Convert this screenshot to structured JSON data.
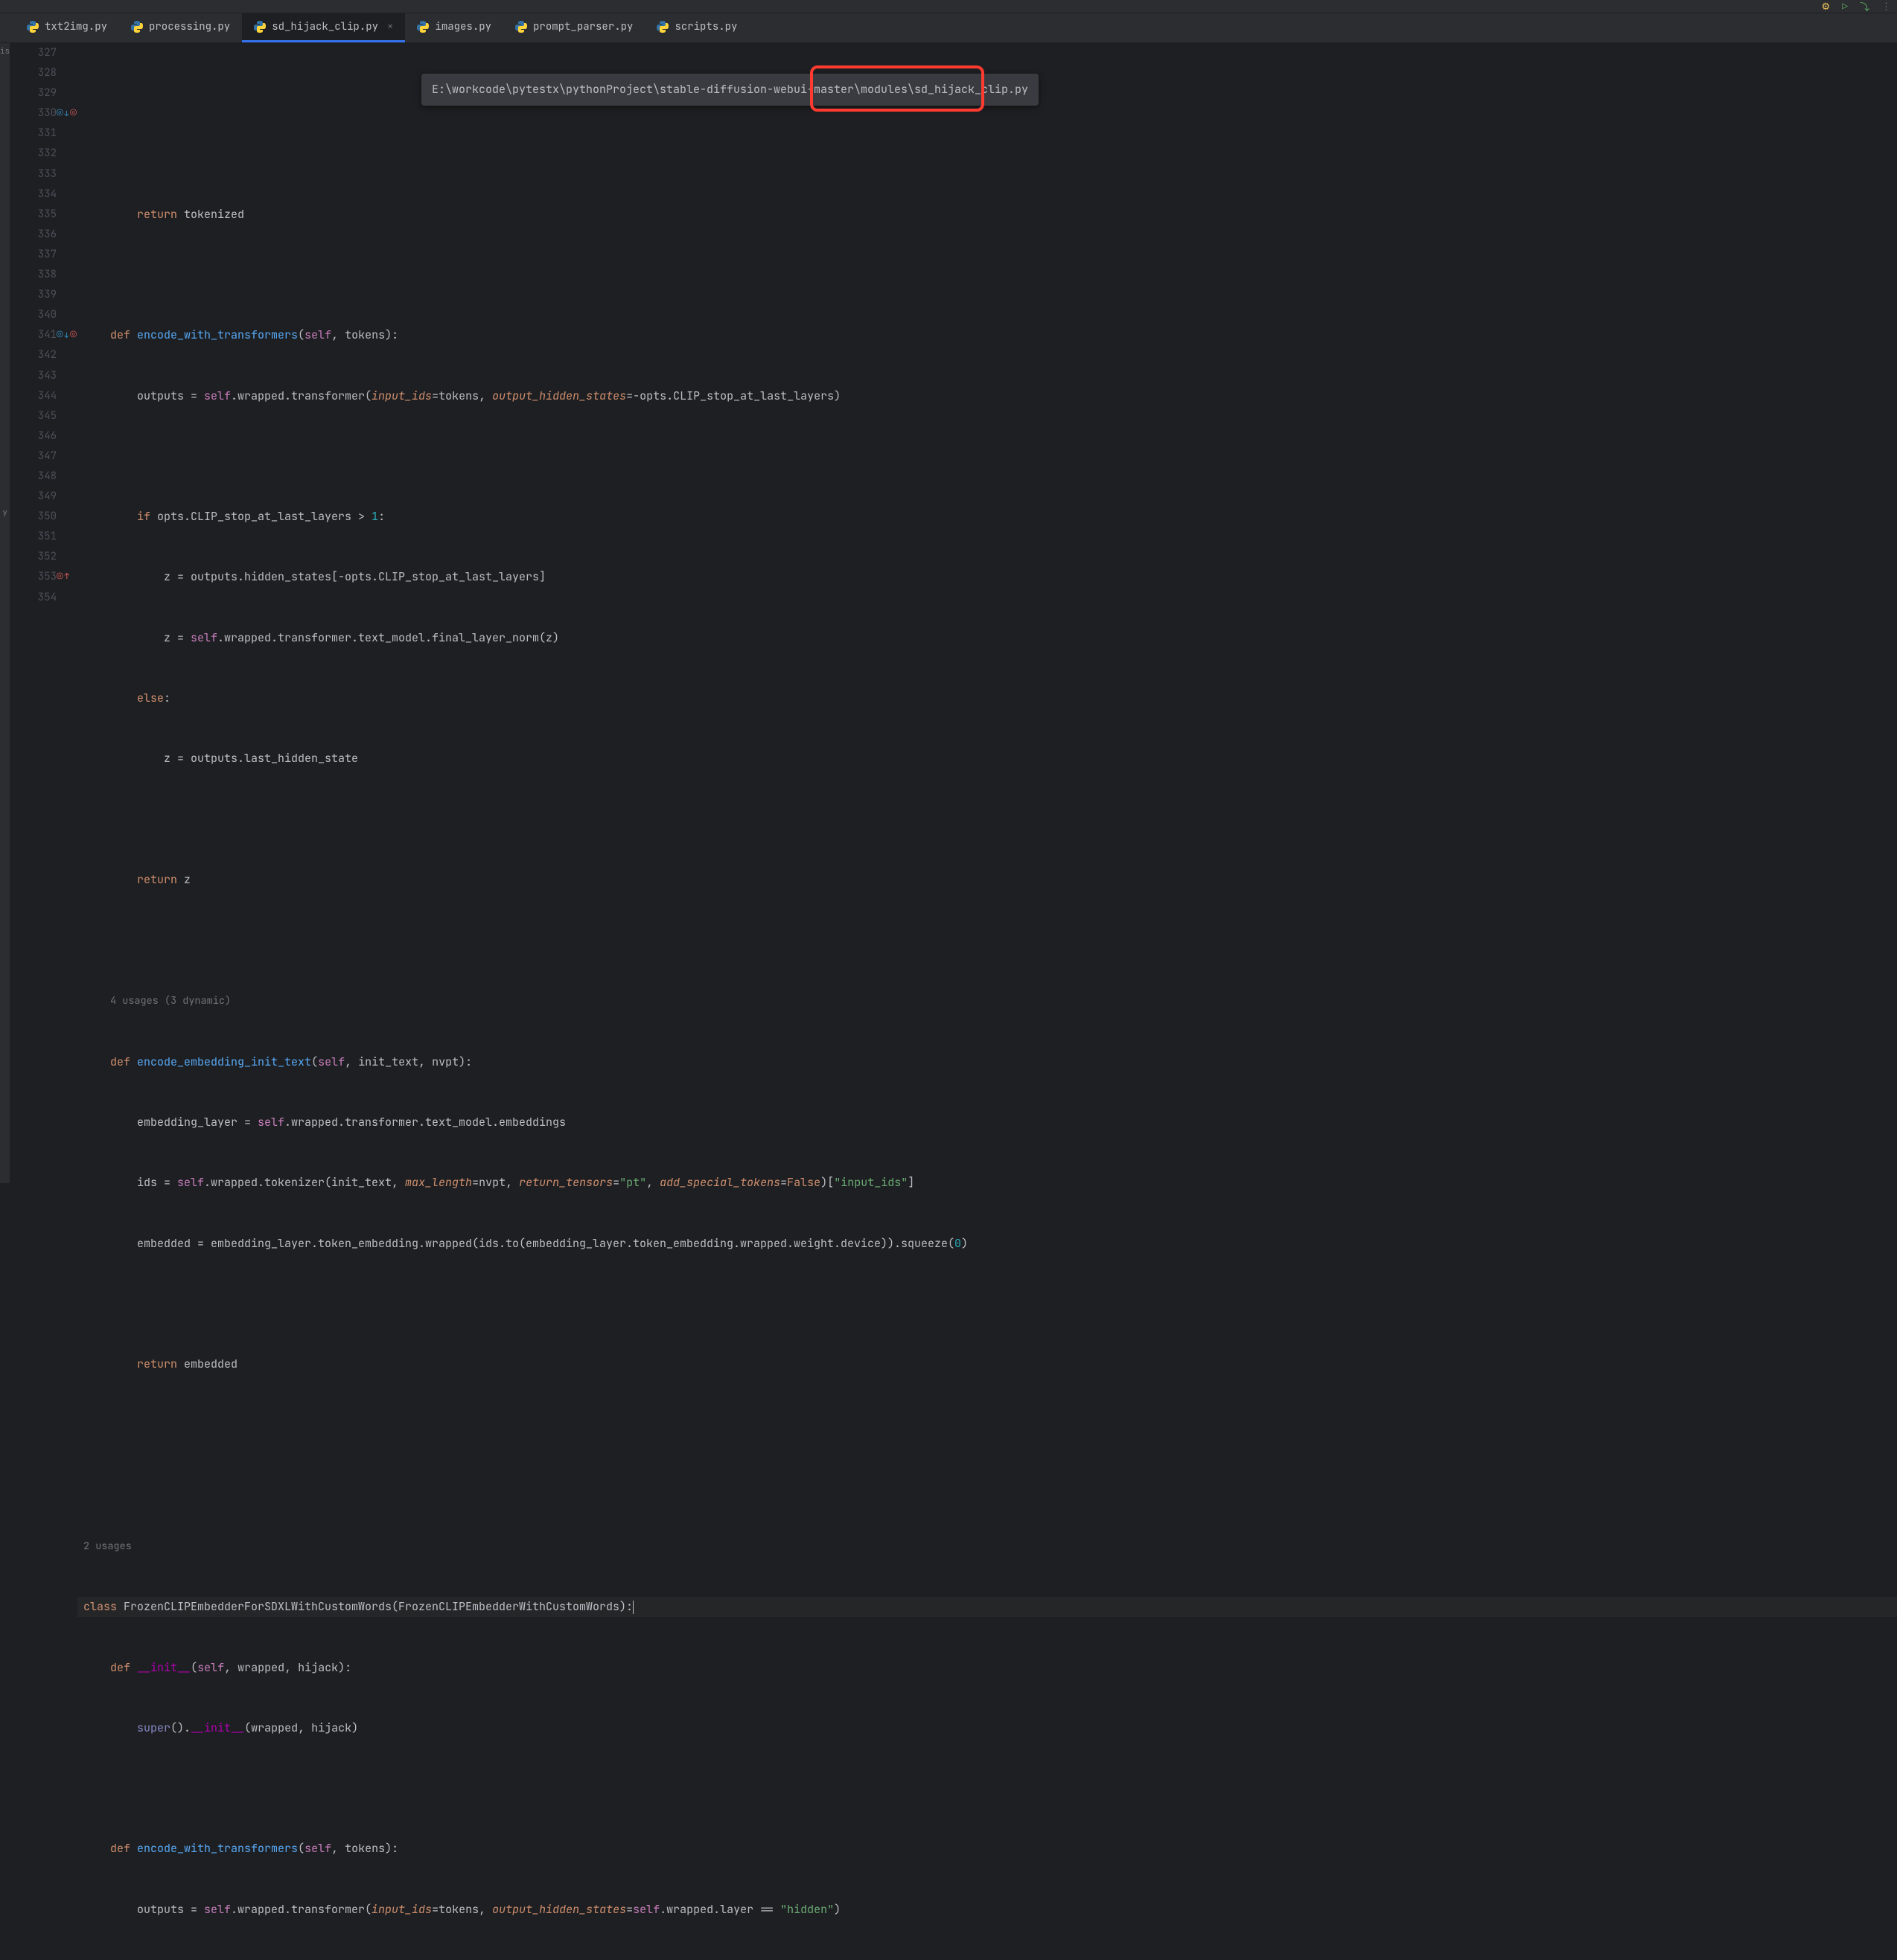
{
  "toolbar": {
    "title_fragment": "",
    "right_glyphs": [
      "⟳",
      "▷",
      "⋮"
    ]
  },
  "tabs": [
    {
      "label": "txt2img.py",
      "active": false,
      "closeable": false
    },
    {
      "label": "processing.py",
      "active": false,
      "closeable": false
    },
    {
      "label": "sd_hijack_clip.py",
      "active": true,
      "closeable": true
    },
    {
      "label": "images.py",
      "active": false,
      "closeable": false
    },
    {
      "label": "prompt_parser.py",
      "active": false,
      "closeable": false
    },
    {
      "label": "scripts.py",
      "active": false,
      "closeable": false
    }
  ],
  "tooltip_path": "E:\\workcode\\pytestx\\pythonProject\\stable-diffusion-webui-master\\modules\\sd_hijack_clip.py",
  "gutter": {
    "lines": [
      "327",
      "328",
      "329",
      "330",
      "331",
      "332",
      "333",
      "334",
      "335",
      "336",
      "337",
      "338",
      "339",
      "340",
      "",
      "341",
      "342",
      "343",
      "344",
      "345",
      "346",
      "347",
      "348",
      "",
      "349",
      "350",
      "351",
      "352",
      "353",
      "354"
    ],
    "markers": {
      "330": "usage-down",
      "341": "usage-down",
      "353": "override-up"
    }
  },
  "annotations": {
    "usage_341": "4 usages (3 dynamic)",
    "usage_349": "2 usages"
  },
  "code": {
    "l327": "",
    "l328": {
      "kw": "return",
      "rest": " tokenized"
    },
    "l329": "",
    "l330": {
      "kw": "def ",
      "fn": "encode_with_transformers",
      "sig_open": "(",
      "self": "self",
      "sig_rest": ", tokens):"
    },
    "l331": {
      "pre": "        outputs = ",
      "self": "self",
      "mid": ".wrapped.transformer(",
      "arg1": "input_ids",
      "eq1": "=tokens, ",
      "arg2": "output_hidden_states",
      "eq2": "=-opts.CLIP_stop_at_last_layers)"
    },
    "l332": "",
    "l333": {
      "kw": "if",
      "rest": " opts.CLIP_stop_at_last_layers > ",
      "num": "1",
      "tail": ":"
    },
    "l334": "            z = outputs.hidden_states[-opts.CLIP_stop_at_last_layers]",
    "l335": {
      "pre": "            z = ",
      "self": "self",
      "rest": ".wrapped.transformer.text_model.final_layer_norm(z)"
    },
    "l336": {
      "kw": "else",
      "rest": ":"
    },
    "l337": "            z = outputs.last_hidden_state",
    "l338": "",
    "l339": {
      "kw": "return",
      "rest": " z"
    },
    "l340": "",
    "l341": {
      "kw": "def ",
      "fn": "encode_embedding_init_text",
      "sig_open": "(",
      "self": "self",
      "sig_rest": ", init_text, nvpt):"
    },
    "l342": {
      "pre": "        embedding_layer = ",
      "self": "self",
      "rest": ".wrapped.transformer.text_model.embeddings"
    },
    "l343": {
      "pre": "        ids = ",
      "self": "self",
      "mid": ".wrapped.tokenizer(init_text, ",
      "arg1": "max_length",
      "eq1": "=nvpt, ",
      "arg2": "return_tensors",
      "eq2": "=",
      "str1": "\"pt\"",
      "c": ", ",
      "arg3": "add_special_tokens",
      "eq3": "=",
      "bool": "False",
      "tail": ")[",
      "str2": "\"input_ids\"",
      "tail2": "]"
    },
    "l344": {
      "pre": "        embedded = embedding_layer.token_embedding.wrapped(ids.to(embedding_layer.token_embedding.wrapped.weight.device)).squeeze(",
      "num": "0",
      "tail": ")"
    },
    "l345": "",
    "l346": {
      "kw": "return",
      "rest": " embedded"
    },
    "l347": "",
    "l348": "",
    "l349": {
      "kw": "class ",
      "cls": "FrozenCLIPEmbedderForSDXLWithCustomWords",
      "paren": "(FrozenCLIPEmbedderWithCustomWords):"
    },
    "l350": {
      "kw": "def ",
      "dunder": "__init__",
      "sig_open": "(",
      "self": "self",
      "sig_rest": ", wrapped, hijack):"
    },
    "l351": {
      "pre": "        ",
      "builtin": "super",
      "mid": "().",
      "dunder": "__init__",
      "rest": "(wrapped, hijack)"
    },
    "l352": "",
    "l353": {
      "kw": "def ",
      "fn": "encode_with_transformers",
      "sig_open": "(",
      "self": "self",
      "sig_rest": ", tokens):"
    },
    "l354": {
      "pre": "        outputs = ",
      "self": "self",
      "mid": ".wrapped.transformer(",
      "arg1": "input_ids",
      "eq1": "=tokens, ",
      "arg2": "output_hidden_states",
      "eq2": "=",
      "self2": "self",
      "mid2": ".wrapped.layer == ",
      "str": "\"hidden\"",
      "tail": ")"
    }
  }
}
